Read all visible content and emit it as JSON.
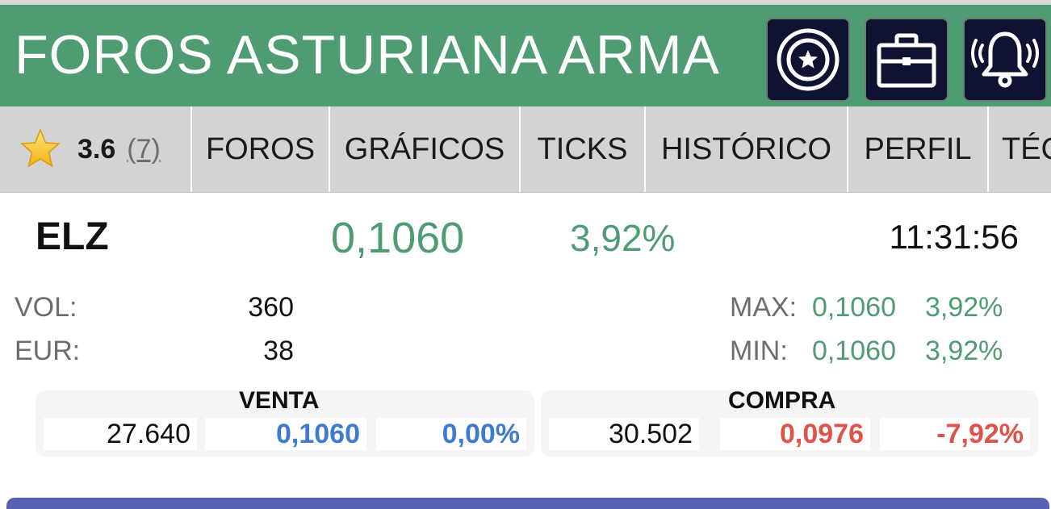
{
  "header": {
    "title": "FOROS ASTURIANA ARMA",
    "buttons": [
      {
        "icon": "star-badge-icon"
      },
      {
        "icon": "briefcase-icon"
      },
      {
        "icon": "bell-icon"
      }
    ]
  },
  "tabs": {
    "rating_value": "3.6",
    "rating_count": "(7)",
    "items": [
      "FOROS",
      "GRÁFICOS",
      "TICKS",
      "HISTÓRICO",
      "PERFIL",
      "TÉC"
    ]
  },
  "quote": {
    "symbol": "ELZ",
    "price": "0,1060",
    "change": "3,92%",
    "time": "11:31:56"
  },
  "stats": {
    "vol_label": "VOL:",
    "vol_value": "360",
    "eur_label": "EUR:",
    "eur_value": "38",
    "max_label": "MAX:",
    "max_price": "0,1060",
    "max_pct": "3,92%",
    "min_label": "MIN:",
    "min_price": "0,1060",
    "min_pct": "3,92%"
  },
  "venta": {
    "title": "VENTA",
    "qty": "27.640",
    "price": "0,1060",
    "pct": "0,00%"
  },
  "compra": {
    "title": "COMPRA",
    "qty": "30.502",
    "price": "0,0976",
    "pct": "-7,92%"
  },
  "colors": {
    "header_green": "#4f9b72",
    "button_navy": "#0f1230",
    "tab_gray": "#d3d3d3",
    "positive_green": "#4f9b72",
    "bid_blue": "#3d7bd0",
    "ask_red": "#e0534a"
  }
}
